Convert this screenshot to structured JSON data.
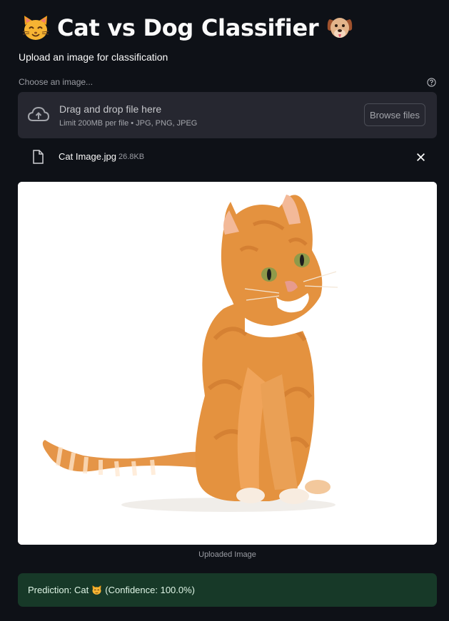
{
  "header": {
    "title": "Cat vs Dog Classifier",
    "left_icon": "cat-face-emoji",
    "right_icon": "dog-face-emoji"
  },
  "subtitle": "Upload an image for classification",
  "uploader": {
    "label": "Choose an image...",
    "drop_text": "Drag and drop file here",
    "limit_text": "Limit 200MB per file • JPG, PNG, JPEG",
    "browse_label": "Browse files"
  },
  "file": {
    "name": "Cat Image.jpg",
    "size": "26.8KB"
  },
  "image": {
    "caption": "Uploaded Image"
  },
  "prediction": {
    "prefix": "Prediction: Cat",
    "icon": "cat-face-emoji",
    "suffix": "(Confidence: 100.0%)"
  },
  "colors": {
    "background": "#0e1117",
    "dropzone": "#262730",
    "success_bg": "#173928",
    "text": "#fafafa",
    "muted": "#9a9ca3"
  }
}
